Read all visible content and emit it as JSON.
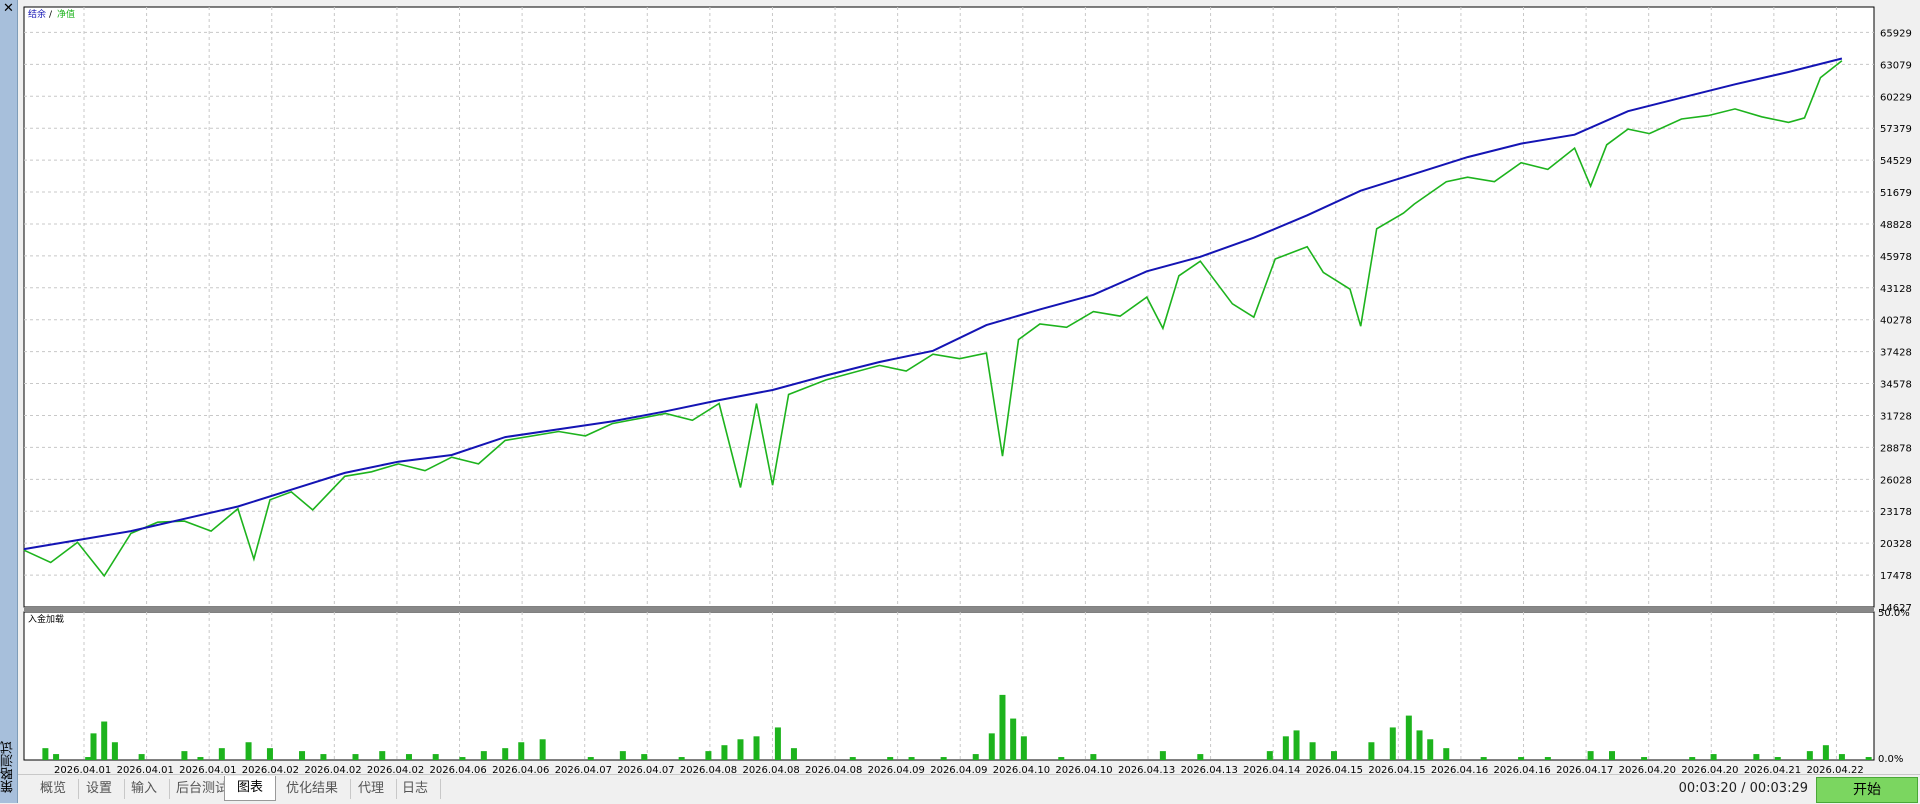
{
  "sidebar": {
    "title": "策略测试",
    "close_icon": "✕"
  },
  "colors": {
    "balance": "#1414b4",
    "equity": "#1db31d",
    "grid": "#c8c8c8",
    "load": "#1db31d"
  },
  "chart_data": [
    {
      "type": "line",
      "title": "",
      "legend": {
        "balance": "结余",
        "separator": "/",
        "equity": "净值",
        "placement": "top-left"
      },
      "ylim": [
        14627,
        68200
      ],
      "yticks": [
        14627,
        17478,
        20328,
        23178,
        26028,
        28878,
        31728,
        34578,
        37428,
        40278,
        43128,
        45978,
        48828,
        51679,
        54529,
        57379,
        60229,
        63079,
        65929
      ],
      "x_range": [
        0,
        29
      ],
      "series": [
        {
          "name": "结余",
          "points": [
            [
              0,
              19800
            ],
            [
              1,
              20600
            ],
            [
              2,
              21400
            ],
            [
              3,
              22500
            ],
            [
              4,
              23600
            ],
            [
              5,
              25100
            ],
            [
              6,
              26600
            ],
            [
              7,
              27600
            ],
            [
              8,
              28200
            ],
            [
              9,
              29800
            ],
            [
              10,
              30500
            ],
            [
              11,
              31200
            ],
            [
              12,
              32100
            ],
            [
              13,
              33100
            ],
            [
              14,
              34000
            ],
            [
              15,
              35300
            ],
            [
              16,
              36500
            ],
            [
              17,
              37500
            ],
            [
              18,
              39800
            ],
            [
              19,
              41200
            ],
            [
              20,
              42500
            ],
            [
              21,
              44600
            ],
            [
              22,
              45900
            ],
            [
              23,
              47600
            ],
            [
              24,
              49600
            ],
            [
              25,
              51800
            ],
            [
              26,
              53300
            ],
            [
              27,
              54800
            ],
            [
              28,
              56000
            ],
            [
              29,
              56800
            ],
            [
              30,
              58900
            ],
            [
              31,
              60100
            ],
            [
              32,
              61300
            ],
            [
              33,
              62400
            ],
            [
              34,
              63600
            ]
          ]
        },
        {
          "name": "净值",
          "points": [
            [
              0,
              19700
            ],
            [
              0.5,
              18600
            ],
            [
              1,
              20400
            ],
            [
              1.5,
              17400
            ],
            [
              2,
              21200
            ],
            [
              2.5,
              22200
            ],
            [
              3,
              22300
            ],
            [
              3.5,
              21400
            ],
            [
              4,
              23400
            ],
            [
              4.3,
              18900
            ],
            [
              4.6,
              24200
            ],
            [
              5,
              24900
            ],
            [
              5.4,
              23300
            ],
            [
              6,
              26300
            ],
            [
              6.5,
              26700
            ],
            [
              7,
              27400
            ],
            [
              7.5,
              26800
            ],
            [
              8,
              28000
            ],
            [
              8.5,
              27400
            ],
            [
              9,
              29500
            ],
            [
              10,
              30300
            ],
            [
              10.5,
              29900
            ],
            [
              11,
              31000
            ],
            [
              12,
              31900
            ],
            [
              12.5,
              31300
            ],
            [
              13,
              32800
            ],
            [
              13.4,
              25300
            ],
            [
              13.7,
              32800
            ],
            [
              14,
              25500
            ],
            [
              14.3,
              33600
            ],
            [
              15,
              34900
            ],
            [
              16,
              36200
            ],
            [
              16.5,
              35700
            ],
            [
              17,
              37200
            ],
            [
              17.5,
              36800
            ],
            [
              18,
              37300
            ],
            [
              18.3,
              28100
            ],
            [
              18.6,
              38500
            ],
            [
              19,
              39900
            ],
            [
              19.5,
              39600
            ],
            [
              20,
              41000
            ],
            [
              20.5,
              40600
            ],
            [
              21,
              42300
            ],
            [
              21.3,
              39500
            ],
            [
              21.6,
              44200
            ],
            [
              22,
              45500
            ],
            [
              22.6,
              41700
            ],
            [
              23,
              40500
            ],
            [
              23.4,
              45700
            ],
            [
              24,
              46800
            ],
            [
              24.3,
              44500
            ],
            [
              24.8,
              43000
            ],
            [
              25,
              39700
            ],
            [
              25.3,
              48400
            ],
            [
              25.8,
              49800
            ],
            [
              26,
              50600
            ],
            [
              26.6,
              52600
            ],
            [
              27,
              53000
            ],
            [
              27.5,
              52600
            ],
            [
              28,
              54300
            ],
            [
              28.5,
              53700
            ],
            [
              29,
              55600
            ],
            [
              29.3,
              52200
            ],
            [
              29.6,
              55900
            ],
            [
              30,
              57300
            ],
            [
              30.4,
              56900
            ],
            [
              31,
              58200
            ],
            [
              31.5,
              58500
            ],
            [
              32,
              59100
            ],
            [
              32.5,
              58400
            ],
            [
              33,
              57900
            ],
            [
              33.3,
              58300
            ],
            [
              33.6,
              61900
            ],
            [
              34,
              63400
            ]
          ]
        }
      ],
      "xticks": [
        "2026.04.01",
        "2026.04.01",
        "2026.04.01",
        "2026.04.02",
        "2026.04.02",
        "2026.04.02",
        "2026.04.06",
        "2026.04.06",
        "2026.04.07",
        "2026.04.07",
        "2026.04.08",
        "2026.04.08",
        "2026.04.08",
        "2026.04.09",
        "2026.04.09",
        "2026.04.10",
        "2026.04.10",
        "2026.04.13",
        "2026.04.13",
        "2026.04.14",
        "2026.04.15",
        "2026.04.15",
        "2026.04.16",
        "2026.04.16",
        "2026.04.17",
        "2026.04.20",
        "2026.04.20",
        "2026.04.21",
        "2026.04.22"
      ]
    },
    {
      "type": "bar",
      "title": "入金加载",
      "ylim": [
        0,
        50
      ],
      "yticks_labels": [
        "0.0%",
        "50.0%"
      ],
      "series": [
        {
          "name": "入金加载",
          "points": [
            [
              0.4,
              4
            ],
            [
              0.6,
              2
            ],
            [
              1.2,
              1
            ],
            [
              1.3,
              9
            ],
            [
              1.5,
              13
            ],
            [
              1.7,
              6
            ],
            [
              2.2,
              2
            ],
            [
              3,
              3
            ],
            [
              3.3,
              1
            ],
            [
              3.7,
              4
            ],
            [
              4.2,
              6
            ],
            [
              4.6,
              4
            ],
            [
              5.2,
              3
            ],
            [
              5.6,
              2
            ],
            [
              6.2,
              2
            ],
            [
              6.7,
              3
            ],
            [
              7.2,
              2
            ],
            [
              7.7,
              2
            ],
            [
              8.2,
              1
            ],
            [
              8.6,
              3
            ],
            [
              9,
              4
            ],
            [
              9.3,
              6
            ],
            [
              9.7,
              7
            ],
            [
              10.6,
              1
            ],
            [
              11.2,
              3
            ],
            [
              11.6,
              2
            ],
            [
              12.3,
              1
            ],
            [
              12.8,
              3
            ],
            [
              13.1,
              5
            ],
            [
              13.4,
              7
            ],
            [
              13.7,
              8
            ],
            [
              14.1,
              11
            ],
            [
              14.4,
              4
            ],
            [
              15.5,
              1
            ],
            [
              16.2,
              1
            ],
            [
              16.6,
              1
            ],
            [
              17.2,
              1
            ],
            [
              17.8,
              2
            ],
            [
              18.1,
              9
            ],
            [
              18.3,
              22
            ],
            [
              18.5,
              14
            ],
            [
              18.7,
              8
            ],
            [
              19.4,
              1
            ],
            [
              20,
              2
            ],
            [
              21.3,
              3
            ],
            [
              22,
              2
            ],
            [
              23.3,
              3
            ],
            [
              23.6,
              8
            ],
            [
              23.8,
              10
            ],
            [
              24.1,
              6
            ],
            [
              24.5,
              3
            ],
            [
              25.2,
              6
            ],
            [
              25.6,
              11
            ],
            [
              25.9,
              15
            ],
            [
              26.1,
              10
            ],
            [
              26.3,
              7
            ],
            [
              26.6,
              4
            ],
            [
              27.3,
              1
            ],
            [
              28,
              1
            ],
            [
              28.5,
              1
            ],
            [
              29.3,
              3
            ],
            [
              29.7,
              3
            ],
            [
              30.3,
              1
            ],
            [
              31.2,
              1
            ],
            [
              31.6,
              2
            ],
            [
              32.4,
              2
            ],
            [
              32.8,
              1
            ],
            [
              33.4,
              3
            ],
            [
              33.7,
              5
            ],
            [
              34,
              2
            ],
            [
              34.5,
              1
            ]
          ]
        }
      ]
    }
  ],
  "bottom": {
    "tabs": [
      "概览",
      "设置",
      "输入",
      "后台测试",
      "图表",
      "优化结果",
      "代理",
      "日志"
    ],
    "active_tab": "图表",
    "time": "00:03:20 / 00:03:29",
    "start": "开始"
  }
}
